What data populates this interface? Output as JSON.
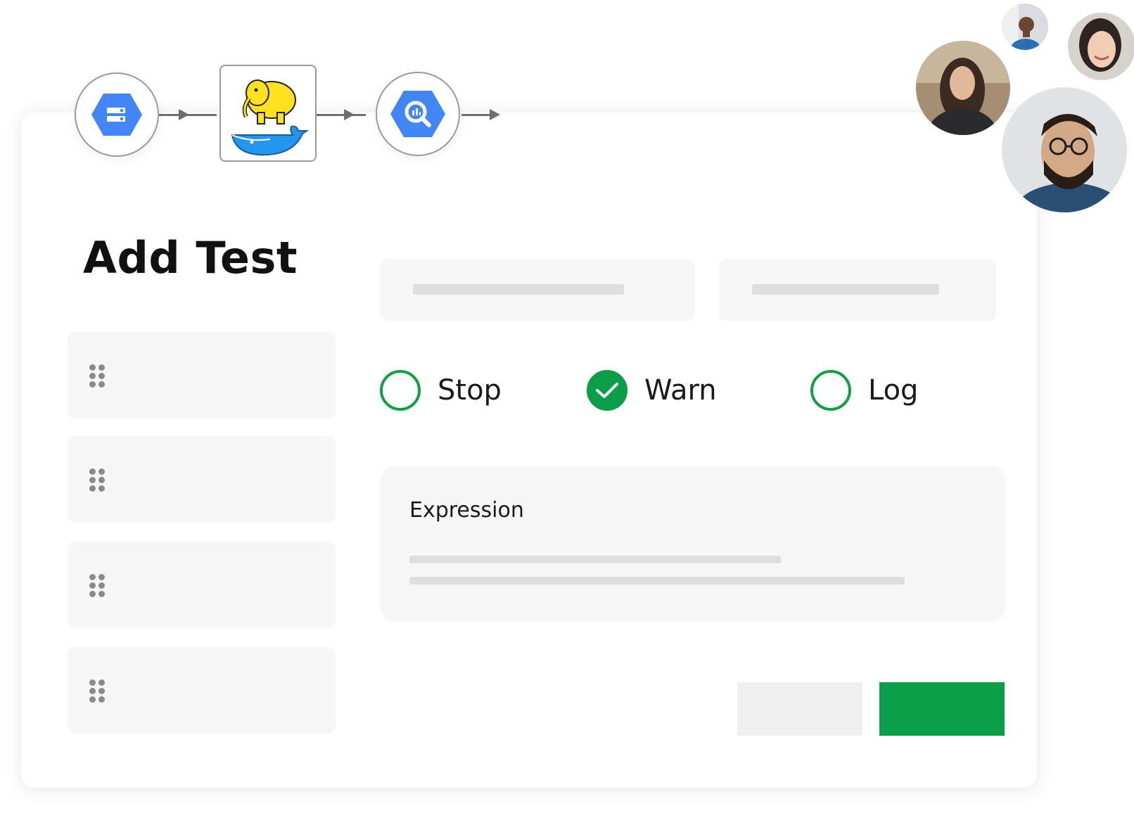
{
  "page": {
    "title": "Add Test"
  },
  "pipeline": {
    "nodes": [
      {
        "icon": "cloud-storage-icon"
      },
      {
        "icon": "hadoop-docker-icon"
      },
      {
        "icon": "bigquery-icon"
      }
    ],
    "accent_color": "#4285f4"
  },
  "severity": {
    "options": [
      {
        "label": "Stop",
        "checked": false
      },
      {
        "label": "Warn",
        "checked": true
      },
      {
        "label": "Log",
        "checked": false
      }
    ],
    "color": "#099e47"
  },
  "expression": {
    "label": "Expression"
  },
  "actions": {
    "primary_color": "#099e47",
    "secondary_color": "#efefef"
  },
  "collaborators": [
    {
      "icon": "avatar-man-small"
    },
    {
      "icon": "avatar-woman-long-hair"
    },
    {
      "icon": "avatar-woman-smiling"
    },
    {
      "icon": "avatar-man-glasses"
    }
  ]
}
